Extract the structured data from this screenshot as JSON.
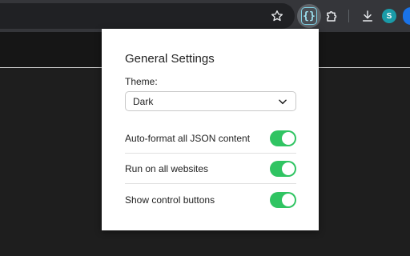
{
  "toolbar": {
    "icons": [
      "star-icon",
      "json-extension-icon",
      "puzzle-icon",
      "download-icon"
    ],
    "json_button_glyph": "{}",
    "avatar_initial": "S",
    "colors": {
      "toolbar_bg": "#35363a",
      "avatar": "#1a9ba8",
      "accent": "#1a73e8"
    }
  },
  "popup": {
    "title": "General Settings",
    "theme": {
      "label": "Theme:",
      "selected": "Dark"
    },
    "options": [
      {
        "label": "Auto-format all JSON content",
        "enabled": true
      },
      {
        "label": "Run on all websites",
        "enabled": true
      },
      {
        "label": "Show control buttons",
        "enabled": true
      }
    ],
    "colors": {
      "toggle_on": "#30c462",
      "popup_bg": "#ffffff"
    }
  }
}
